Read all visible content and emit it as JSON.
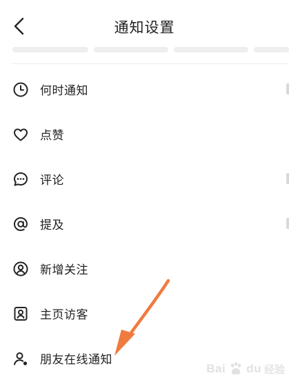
{
  "header": {
    "title": "通知设置",
    "back_icon": "chevron-left-icon"
  },
  "menu": {
    "items": [
      {
        "label": "何时通知",
        "icon": "clock-icon"
      },
      {
        "label": "点赞",
        "icon": "heart-icon"
      },
      {
        "label": "评论",
        "icon": "comment-icon"
      },
      {
        "label": "提及",
        "icon": "at-sign-icon"
      },
      {
        "label": "新增关注",
        "icon": "user-circle-icon"
      },
      {
        "label": "主页访客",
        "icon": "user-card-icon"
      },
      {
        "label": "朋友在线通知",
        "icon": "user-online-icon"
      }
    ]
  },
  "annotation": {
    "arrow_color": "#f07b3f"
  },
  "watermark": {
    "brand": "Bai",
    "brand2": "du",
    "sub": "经验"
  }
}
